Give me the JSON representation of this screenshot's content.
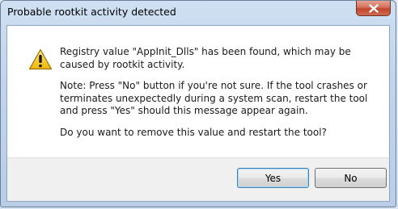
{
  "window": {
    "title": "Probable rootkit activity detected",
    "close_icon": "close-icon"
  },
  "message": {
    "icon": "warning-icon",
    "paragraph1": "Registry value \"AppInit_Dlls\" has been found, which may be caused by rootkit activity.",
    "paragraph2": "Note: Press \"No\" button if you're not sure. If the tool crashes or terminates unexpectedly during a system scan, restart the tool and press \"Yes\" should this message appear again.",
    "paragraph3": "Do you want to remove this value and restart the tool?"
  },
  "buttons": {
    "yes_label": "Yes",
    "no_label": "No"
  },
  "colors": {
    "close_button": "#c2452d",
    "warning_fill": "#f5c518",
    "default_button_border": "#3c7fb1"
  }
}
